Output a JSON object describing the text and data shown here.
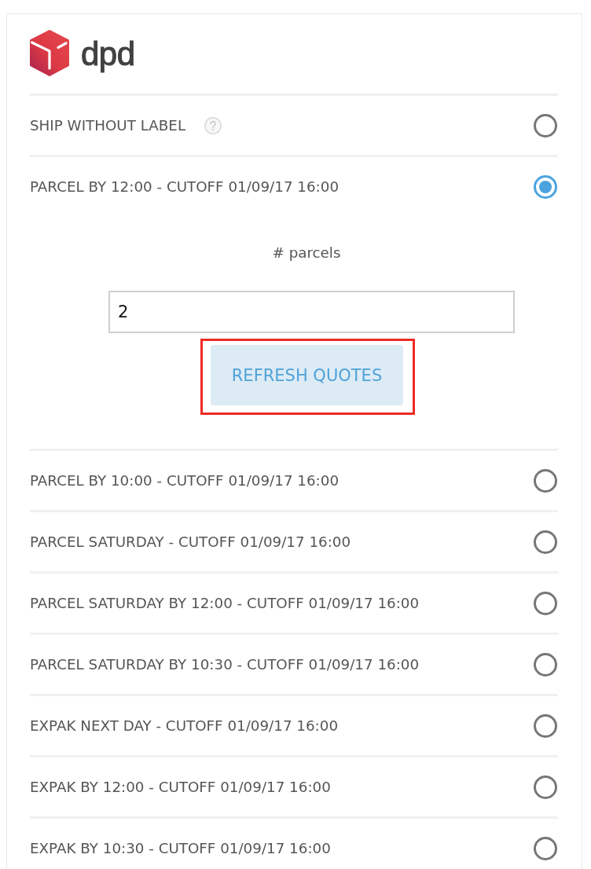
{
  "brand": {
    "wordmark": "dpd"
  },
  "options": [
    {
      "label": "SHIP WITHOUT LABEL",
      "help": true,
      "selected": false
    },
    {
      "label": "PARCEL BY 12:00 - CUTOFF 01/09/17 16:00",
      "help": false,
      "selected": true,
      "details": {
        "field_label": "# parcels",
        "value": "2",
        "button": {
          "label": "REFRESH QUOTES",
          "highlighted": true
        }
      }
    },
    {
      "label": "PARCEL BY 10:00 - CUTOFF 01/09/17 16:00",
      "help": false,
      "selected": false
    },
    {
      "label": "PARCEL SATURDAY - CUTOFF 01/09/17 16:00",
      "help": false,
      "selected": false
    },
    {
      "label": "PARCEL SATURDAY BY 12:00 - CUTOFF 01/09/17 16:00",
      "help": false,
      "selected": false
    },
    {
      "label": "PARCEL SATURDAY BY 10:30 - CUTOFF 01/09/17 16:00",
      "help": false,
      "selected": false
    },
    {
      "label": "EXPAK NEXT DAY - CUTOFF 01/09/17 16:00",
      "help": false,
      "selected": false
    },
    {
      "label": "EXPAK BY 12:00 - CUTOFF 01/09/17 16:00",
      "help": false,
      "selected": false
    },
    {
      "label": "EXPAK BY 10:30 - CUTOFF 01/09/17 16:00",
      "help": false,
      "selected": false
    }
  ]
}
